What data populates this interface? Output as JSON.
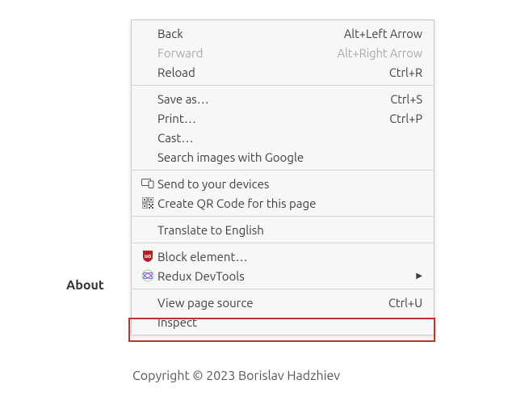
{
  "background": {
    "about": "About",
    "copyright": "Copyright © 2023 Borislav Hadzhiev"
  },
  "menu": {
    "back": {
      "label": "Back",
      "shortcut": "Alt+Left Arrow"
    },
    "forward": {
      "label": "Forward",
      "shortcut": "Alt+Right Arrow"
    },
    "reload": {
      "label": "Reload",
      "shortcut": "Ctrl+R"
    },
    "save_as": {
      "label": "Save as…",
      "shortcut": "Ctrl+S"
    },
    "print": {
      "label": "Print…",
      "shortcut": "Ctrl+P"
    },
    "cast": {
      "label": "Cast…"
    },
    "search_images": {
      "label": "Search images with Google"
    },
    "send_devices": {
      "label": "Send to your devices"
    },
    "create_qr": {
      "label": "Create QR Code for this page"
    },
    "translate": {
      "label": "Translate to English"
    },
    "block_element": {
      "label": "Block element…"
    },
    "redux": {
      "label": "Redux DevTools"
    },
    "view_source": {
      "label": "View page source",
      "shortcut": "Ctrl+U"
    },
    "inspect": {
      "label": "Inspect"
    }
  },
  "highlight_target": "inspect"
}
